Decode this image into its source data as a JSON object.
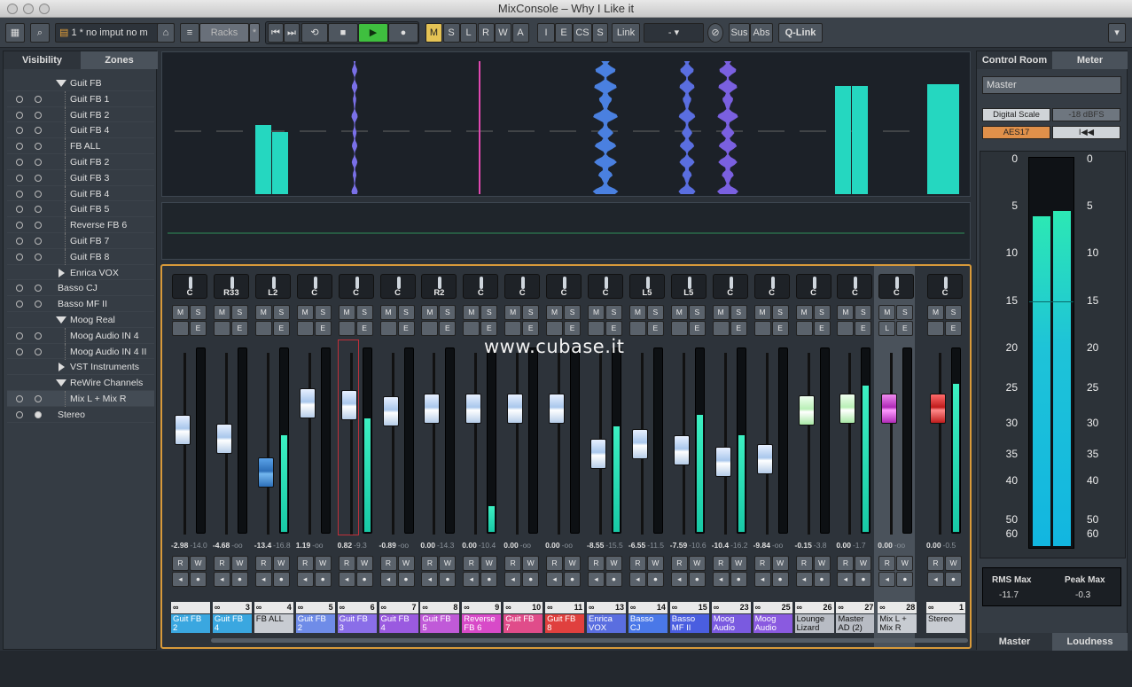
{
  "window": {
    "title": "MixConsole – Why I Like it"
  },
  "toolbar": {
    "preset": "1 * no imput no m",
    "racks": "Racks",
    "star": "*",
    "mode_buttons": [
      "M",
      "S",
      "L",
      "R",
      "W",
      "A"
    ],
    "mode2_buttons": [
      "I",
      "E",
      "CS",
      "S"
    ],
    "link": "Link",
    "link_value": "-",
    "sus": "Sus",
    "abs": "Abs",
    "qlink": "Q-Link"
  },
  "left_panel": {
    "tabs": [
      "Visibility",
      "Zones"
    ],
    "rows": [
      {
        "label": "Guit FB",
        "indent": 2,
        "folder": true,
        "dots": 0
      },
      {
        "label": "Guit FB 1",
        "indent": 3,
        "dots": 2
      },
      {
        "label": "Guit FB 2",
        "indent": 3,
        "dots": 2
      },
      {
        "label": "Guit FB 4",
        "indent": 3,
        "dots": 2
      },
      {
        "label": "FB ALL",
        "indent": 3,
        "dots": 2
      },
      {
        "label": "Guit FB 2",
        "indent": 3,
        "dots": 2
      },
      {
        "label": "Guit FB 3",
        "indent": 3,
        "dots": 2
      },
      {
        "label": "Guit FB 4",
        "indent": 3,
        "dots": 2
      },
      {
        "label": "Guit FB 5",
        "indent": 3,
        "dots": 2
      },
      {
        "label": "Reverse FB 6",
        "indent": 3,
        "dots": 2
      },
      {
        "label": "Guit FB 7",
        "indent": 3,
        "dots": 2
      },
      {
        "label": "Guit FB 8",
        "indent": 3,
        "dots": 2
      },
      {
        "label": "Enrica VOX",
        "indent": 2,
        "folder": true,
        "collapsed": true,
        "dots": 0
      },
      {
        "label": "Basso CJ",
        "indent": 1,
        "dots": 2
      },
      {
        "label": "Basso MF II",
        "indent": 1,
        "dots": 2
      },
      {
        "label": "Moog Real",
        "indent": 2,
        "folder": true,
        "dots": 0
      },
      {
        "label": "Moog Audio IN 4",
        "indent": 3,
        "dots": 2
      },
      {
        "label": "Moog Audio IN 4 II",
        "indent": 3,
        "dots": 2
      },
      {
        "label": "VST Instruments",
        "indent": 2,
        "folder": true,
        "collapsed": true,
        "dots": 0
      },
      {
        "label": "ReWire Channels",
        "indent": 2,
        "folder": true,
        "dots": 0
      },
      {
        "label": "Mix  L + Mix  R",
        "indent": 3,
        "dots": 2,
        "selected": true
      },
      {
        "label": "Stereo",
        "indent": 1,
        "dots": 2,
        "filled": true
      }
    ]
  },
  "watermark": "www.cubase.it",
  "channels": [
    {
      "pan": "C",
      "vol": "-2.98",
      "peak": "-14.0",
      "num": "",
      "name": "Guit FB 2",
      "color": "#3aa7e0",
      "fader": 0.63,
      "meter": 0.0
    },
    {
      "pan": "R33",
      "vol": "-4.68",
      "peak": "-oo",
      "num": "3",
      "name": "Guit FB 4",
      "color": "#3aa7e0",
      "fader": 0.58,
      "meter": 0.0
    },
    {
      "pan": "L2",
      "vol": "-13.4",
      "peak": "-16.8",
      "num": "4",
      "name": "FB ALL",
      "color": "#c8ccd2",
      "fader": 0.38,
      "meter": 0.53
    },
    {
      "pan": "C",
      "vol": "1.19",
      "peak": "-oo",
      "num": "5",
      "name": "Guit FB 2",
      "color": "#6f8ce8",
      "fader": 0.79,
      "meter": 0.0
    },
    {
      "pan": "C",
      "vol": "0.82",
      "peak": "-9.3",
      "num": "6",
      "name": "Guit FB 3",
      "color": "#8a6ee8",
      "fader": 0.78,
      "meter": 0.62,
      "sel": true
    },
    {
      "pan": "C",
      "vol": "-0.89",
      "peak": "-oo",
      "num": "7",
      "name": "Guit FB 4",
      "color": "#9a5ae0",
      "fader": 0.74,
      "meter": 0.0
    },
    {
      "pan": "R2",
      "vol": "0.00",
      "peak": "-14.3",
      "num": "8",
      "name": "Guit FB 5",
      "color": "#c05ad8",
      "fader": 0.76,
      "meter": 0.0
    },
    {
      "pan": "C",
      "vol": "0.00",
      "peak": "-10.4",
      "num": "9",
      "name": "Reverse FB 6",
      "color": "#d84ac8",
      "fader": 0.76,
      "meter": 0.14
    },
    {
      "pan": "C",
      "vol": "0.00",
      "peak": "-oo",
      "num": "10",
      "name": "Guit FB 7",
      "color": "#e04c8a",
      "fader": 0.76,
      "meter": 0.0
    },
    {
      "pan": "C",
      "vol": "0.00",
      "peak": "-oo",
      "num": "11",
      "name": "Guit FB 8",
      "color": "#e0403e",
      "fader": 0.76,
      "meter": 0.0
    },
    {
      "pan": "C",
      "vol": "-8.55",
      "peak": "-15.5",
      "num": "13",
      "name": "Enrica VOX",
      "color": "#5a6ee0",
      "fader": 0.49,
      "meter": 0.58
    },
    {
      "pan": "L5",
      "vol": "-6.55",
      "peak": "-11.5",
      "num": "14",
      "name": "Basso CJ",
      "color": "#4a78e8",
      "fader": 0.55,
      "meter": 0.0
    },
    {
      "pan": "L5",
      "vol": "-7.59",
      "peak": "-10.6",
      "num": "15",
      "name": "Basso MF II",
      "color": "#4a5ee0",
      "fader": 0.51,
      "meter": 0.64
    },
    {
      "pan": "C",
      "vol": "-10.4",
      "peak": "-16.2",
      "num": "23",
      "name": "Moog Audio",
      "color": "#7a5ae0",
      "fader": 0.44,
      "meter": 0.53
    },
    {
      "pan": "C",
      "vol": "-9.84",
      "peak": "-oo",
      "num": "25",
      "name": "Moog Audio",
      "color": "#8a5ae0",
      "fader": 0.46,
      "meter": 0.0
    },
    {
      "pan": "C",
      "vol": "-0.15",
      "peak": "-3.8",
      "num": "26",
      "name": "Lounge Lizard",
      "color": "#b8bcc4",
      "fader": 0.75,
      "meter": 0.0
    },
    {
      "pan": "C",
      "vol": "0.00",
      "peak": "-1.7",
      "num": "27",
      "name": "Master AD (2)",
      "color": "#b8bcc4",
      "fader": 0.76,
      "meter": 0.8
    },
    {
      "pan": "C",
      "vol": "0.00",
      "peak": "-oo",
      "num": "28",
      "name": "Mix  L + Mix  R",
      "color": "#c8ccd2",
      "fader": 0.76,
      "meter": 0.0,
      "grey": true
    },
    {
      "pan": "C",
      "vol": "0.00",
      "peak": "-0.5",
      "num": "1",
      "name": "Stereo",
      "color": "#c8ccd2",
      "fader": 0.76,
      "meter": 0.81,
      "master": true
    }
  ],
  "right_panel": {
    "tabs": [
      "Control Room",
      "Meter"
    ],
    "master": "Master",
    "digital_scale": "Digital Scale",
    "dbfs": "-18 dBFS",
    "aes": "AES17",
    "reset": "I◀◀",
    "scale": [
      "0",
      "5",
      "10",
      "15",
      "20",
      "25",
      "30",
      "35",
      "40",
      "50",
      "60"
    ],
    "rms_label": "RMS Max",
    "rms_value": "-11.7",
    "peak_label": "Peak Max",
    "peak_value": "-0.3",
    "bottom_tabs": [
      "Master",
      "Loudness"
    ]
  }
}
